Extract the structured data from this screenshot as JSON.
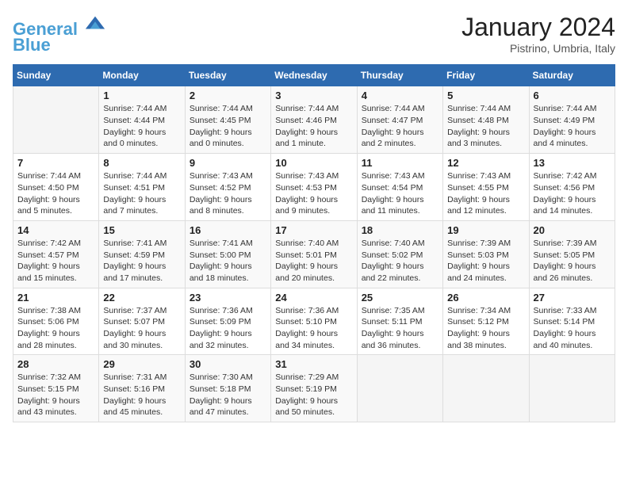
{
  "header": {
    "logo_line1": "General",
    "logo_line2": "Blue",
    "month_title": "January 2024",
    "location": "Pistrino, Umbria, Italy"
  },
  "weekdays": [
    "Sunday",
    "Monday",
    "Tuesday",
    "Wednesday",
    "Thursday",
    "Friday",
    "Saturday"
  ],
  "weeks": [
    [
      {
        "day": "",
        "info": ""
      },
      {
        "day": "1",
        "info": "Sunrise: 7:44 AM\nSunset: 4:44 PM\nDaylight: 9 hours\nand 0 minutes."
      },
      {
        "day": "2",
        "info": "Sunrise: 7:44 AM\nSunset: 4:45 PM\nDaylight: 9 hours\nand 0 minutes."
      },
      {
        "day": "3",
        "info": "Sunrise: 7:44 AM\nSunset: 4:46 PM\nDaylight: 9 hours\nand 1 minute."
      },
      {
        "day": "4",
        "info": "Sunrise: 7:44 AM\nSunset: 4:47 PM\nDaylight: 9 hours\nand 2 minutes."
      },
      {
        "day": "5",
        "info": "Sunrise: 7:44 AM\nSunset: 4:48 PM\nDaylight: 9 hours\nand 3 minutes."
      },
      {
        "day": "6",
        "info": "Sunrise: 7:44 AM\nSunset: 4:49 PM\nDaylight: 9 hours\nand 4 minutes."
      }
    ],
    [
      {
        "day": "7",
        "info": "Sunrise: 7:44 AM\nSunset: 4:50 PM\nDaylight: 9 hours\nand 5 minutes."
      },
      {
        "day": "8",
        "info": "Sunrise: 7:44 AM\nSunset: 4:51 PM\nDaylight: 9 hours\nand 7 minutes."
      },
      {
        "day": "9",
        "info": "Sunrise: 7:43 AM\nSunset: 4:52 PM\nDaylight: 9 hours\nand 8 minutes."
      },
      {
        "day": "10",
        "info": "Sunrise: 7:43 AM\nSunset: 4:53 PM\nDaylight: 9 hours\nand 9 minutes."
      },
      {
        "day": "11",
        "info": "Sunrise: 7:43 AM\nSunset: 4:54 PM\nDaylight: 9 hours\nand 11 minutes."
      },
      {
        "day": "12",
        "info": "Sunrise: 7:43 AM\nSunset: 4:55 PM\nDaylight: 9 hours\nand 12 minutes."
      },
      {
        "day": "13",
        "info": "Sunrise: 7:42 AM\nSunset: 4:56 PM\nDaylight: 9 hours\nand 14 minutes."
      }
    ],
    [
      {
        "day": "14",
        "info": "Sunrise: 7:42 AM\nSunset: 4:57 PM\nDaylight: 9 hours\nand 15 minutes."
      },
      {
        "day": "15",
        "info": "Sunrise: 7:41 AM\nSunset: 4:59 PM\nDaylight: 9 hours\nand 17 minutes."
      },
      {
        "day": "16",
        "info": "Sunrise: 7:41 AM\nSunset: 5:00 PM\nDaylight: 9 hours\nand 18 minutes."
      },
      {
        "day": "17",
        "info": "Sunrise: 7:40 AM\nSunset: 5:01 PM\nDaylight: 9 hours\nand 20 minutes."
      },
      {
        "day": "18",
        "info": "Sunrise: 7:40 AM\nSunset: 5:02 PM\nDaylight: 9 hours\nand 22 minutes."
      },
      {
        "day": "19",
        "info": "Sunrise: 7:39 AM\nSunset: 5:03 PM\nDaylight: 9 hours\nand 24 minutes."
      },
      {
        "day": "20",
        "info": "Sunrise: 7:39 AM\nSunset: 5:05 PM\nDaylight: 9 hours\nand 26 minutes."
      }
    ],
    [
      {
        "day": "21",
        "info": "Sunrise: 7:38 AM\nSunset: 5:06 PM\nDaylight: 9 hours\nand 28 minutes."
      },
      {
        "day": "22",
        "info": "Sunrise: 7:37 AM\nSunset: 5:07 PM\nDaylight: 9 hours\nand 30 minutes."
      },
      {
        "day": "23",
        "info": "Sunrise: 7:36 AM\nSunset: 5:09 PM\nDaylight: 9 hours\nand 32 minutes."
      },
      {
        "day": "24",
        "info": "Sunrise: 7:36 AM\nSunset: 5:10 PM\nDaylight: 9 hours\nand 34 minutes."
      },
      {
        "day": "25",
        "info": "Sunrise: 7:35 AM\nSunset: 5:11 PM\nDaylight: 9 hours\nand 36 minutes."
      },
      {
        "day": "26",
        "info": "Sunrise: 7:34 AM\nSunset: 5:12 PM\nDaylight: 9 hours\nand 38 minutes."
      },
      {
        "day": "27",
        "info": "Sunrise: 7:33 AM\nSunset: 5:14 PM\nDaylight: 9 hours\nand 40 minutes."
      }
    ],
    [
      {
        "day": "28",
        "info": "Sunrise: 7:32 AM\nSunset: 5:15 PM\nDaylight: 9 hours\nand 43 minutes."
      },
      {
        "day": "29",
        "info": "Sunrise: 7:31 AM\nSunset: 5:16 PM\nDaylight: 9 hours\nand 45 minutes."
      },
      {
        "day": "30",
        "info": "Sunrise: 7:30 AM\nSunset: 5:18 PM\nDaylight: 9 hours\nand 47 minutes."
      },
      {
        "day": "31",
        "info": "Sunrise: 7:29 AM\nSunset: 5:19 PM\nDaylight: 9 hours\nand 50 minutes."
      },
      {
        "day": "",
        "info": ""
      },
      {
        "day": "",
        "info": ""
      },
      {
        "day": "",
        "info": ""
      }
    ]
  ]
}
